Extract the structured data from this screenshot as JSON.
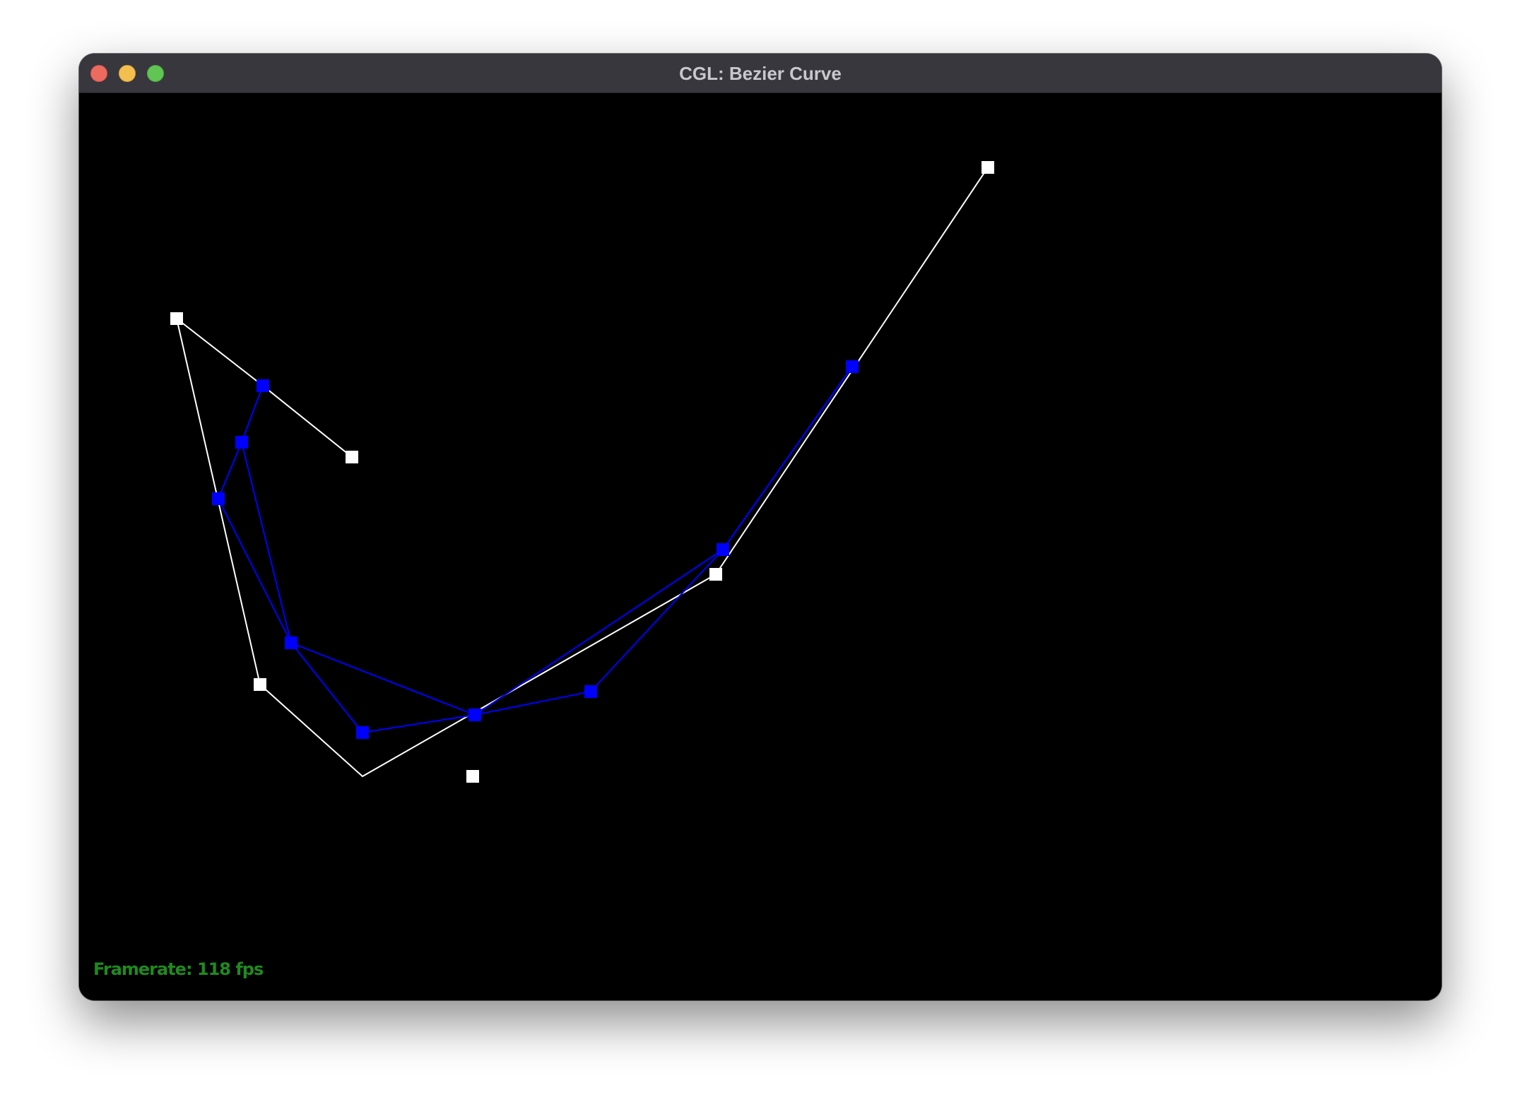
{
  "window": {
    "title": "CGL: Bezier Curve"
  },
  "status": {
    "framerate_text": "Framerate: 118 fps"
  },
  "colors": {
    "background": "#000000",
    "control_points": "#ffffff",
    "intermediate_points": "#0000ff",
    "framerate_text": "#1f8a1f"
  },
  "icons": {
    "close": "traffic-light-close-icon",
    "minimize": "traffic-light-minimize-icon",
    "maximize": "traffic-light-maximize-icon"
  }
}
